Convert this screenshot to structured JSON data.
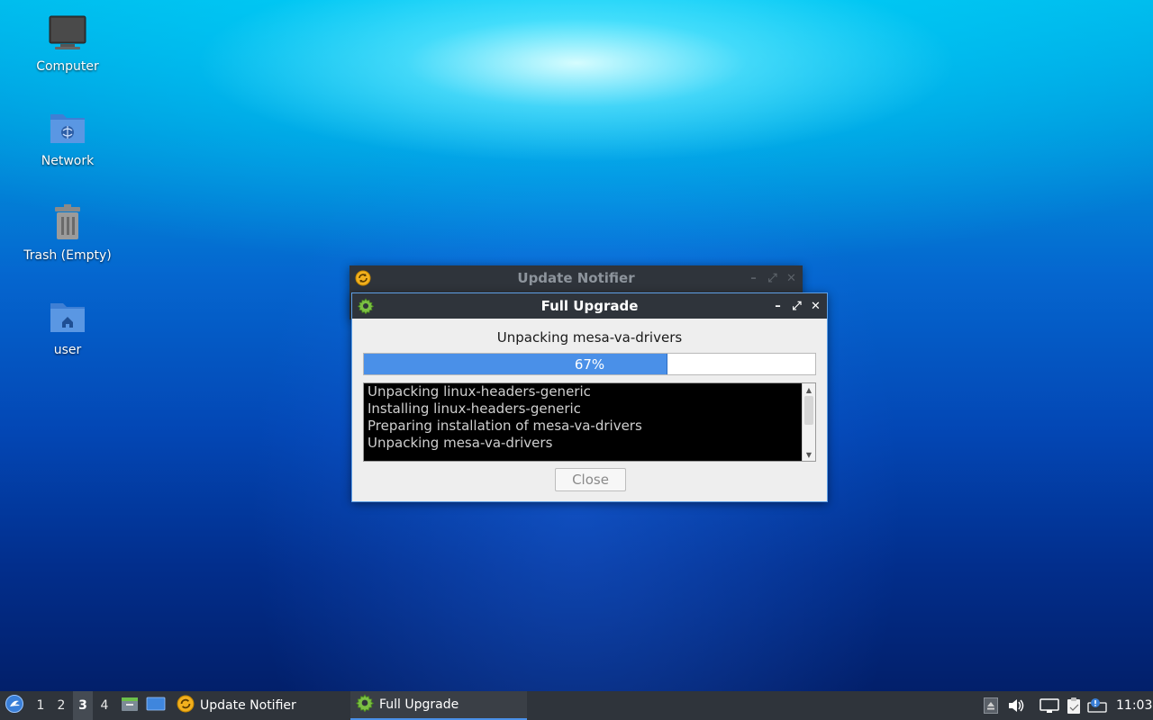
{
  "desktop": {
    "icons": [
      {
        "label": "Computer"
      },
      {
        "label": "Network"
      },
      {
        "label": "Trash (Empty)"
      },
      {
        "label": "user"
      }
    ]
  },
  "windows": {
    "update_notifier": {
      "title": "Update Notifier"
    },
    "full_upgrade": {
      "title": "Full Upgrade",
      "status": "Unpacking mesa-va-drivers",
      "progress_percent": 67,
      "progress_label": "67%",
      "log_lines": [
        "Unpacking linux-headers-generic",
        "Installing linux-headers-generic",
        "Preparing installation of mesa-va-drivers",
        "Unpacking mesa-va-drivers"
      ],
      "close_label": "Close",
      "wm_buttons": {
        "minimize": "–",
        "maximize": "⤢",
        "close": "✕"
      }
    }
  },
  "taskbar": {
    "workspaces": [
      "1",
      "2",
      "3",
      "4"
    ],
    "active_workspace": "3",
    "tasks": [
      {
        "label": "Update Notifier"
      },
      {
        "label": "Full Upgrade"
      }
    ],
    "clock": "11:03"
  },
  "colors": {
    "accent": "#4a90e8",
    "titlebar": "#2f343b",
    "terminal_bg": "#000000"
  },
  "icons": {
    "start": "lubuntu-logo-icon",
    "file_manager": "file-manager-icon",
    "show_desktop": "show-desktop-icon",
    "notifier": "update-notifier-icon",
    "upgrade": "gear-icon",
    "tray": [
      "eject-icon",
      "volume-icon",
      "network-icon",
      "clipboard-icon",
      "notification-icon"
    ]
  }
}
